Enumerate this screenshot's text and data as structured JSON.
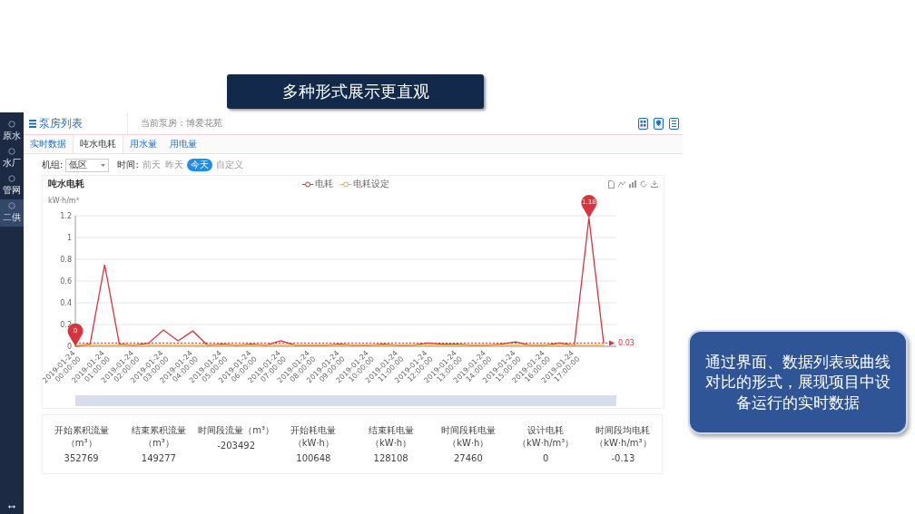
{
  "banner": {
    "title": "多种形式展示更直观"
  },
  "sidebar": {
    "items": [
      {
        "label": "原水",
        "selected": false
      },
      {
        "label": "水厂",
        "selected": false
      },
      {
        "label": "管网",
        "selected": false
      },
      {
        "label": "二供",
        "selected": true
      }
    ]
  },
  "header": {
    "title": "泵房列表",
    "current": "当前泵房：博爱花苑"
  },
  "tabs": [
    {
      "label": "实时数据",
      "selected": false
    },
    {
      "label": "吨水电耗",
      "selected": true
    },
    {
      "label": "用水量",
      "selected": false
    },
    {
      "label": "用电量",
      "selected": false
    }
  ],
  "filters": {
    "unit_label": "机组:",
    "unit_value": "低区",
    "time_label": "时间:",
    "time_options": [
      {
        "label": "前天",
        "selected": false
      },
      {
        "label": "昨天",
        "selected": false
      },
      {
        "label": "今天",
        "selected": true
      },
      {
        "label": "自定义",
        "selected": false
      }
    ]
  },
  "chart": {
    "title": "吨水电耗",
    "chart_data": {
      "type": "line",
      "ylabel": "kW·h/m³",
      "categories": [
        "2019-01-24 00:00:00",
        null,
        "2019-01-24 01:00:00",
        null,
        "2019-01-24 02:00:00",
        null,
        "2019-01-24 03:00:00",
        null,
        "2019-01-24 04:00:00",
        null,
        "2019-01-24 05:00:00",
        null,
        "2019-01-24 06:00:00",
        null,
        "2019-01-24 07:00:00",
        null,
        "2019-01-24 08:00:00",
        null,
        "2019-01-24 09:00:00",
        null,
        "2019-01-24 10:00:00",
        null,
        "2019-01-24 11:00:00",
        null,
        "2019-01-24 12:00:00",
        null,
        "2019-01-24 13:00:00",
        null,
        "2019-01-24 14:00:00",
        null,
        "2019-01-24 15:00:00",
        null,
        "2019-01-24 16:00:00",
        null,
        "2019-01-24 17:00:00",
        null,
        null
      ],
      "ylim": [
        0,
        1.2
      ],
      "yticks": [
        0,
        0.2,
        0.4,
        0.6,
        0.8,
        1,
        1.2
      ],
      "series": [
        {
          "name": "电耗",
          "color": "#d9333f",
          "values": [
            0,
            0.02,
            0.75,
            0.02,
            0.01,
            0.03,
            0.15,
            0.05,
            0.14,
            0.01,
            0.02,
            0.01,
            0.02,
            0.01,
            0.05,
            0.01,
            0.01,
            0.01,
            0.02,
            0.01,
            0.01,
            0.02,
            0.01,
            0.01,
            0.03,
            0.02,
            0.02,
            0.01,
            0.01,
            0.02,
            0.04,
            0.01,
            0.01,
            0.03,
            0.01,
            1.18,
            0.03
          ]
        },
        {
          "name": "电耗设定",
          "color": "#f0b429",
          "values": [
            0.01,
            0.01,
            0.01,
            0.01,
            0.01,
            0.01,
            0.01,
            0.01,
            0.01,
            0.01,
            0.01,
            0.01,
            0.01,
            0.01,
            0.01,
            0.01,
            0.01,
            0.01,
            0.01,
            0.01,
            0.01,
            0.01,
            0.01,
            0.01,
            0.01,
            0.01,
            0.01,
            0.01,
            0.01,
            0.01,
            0.01,
            0.01,
            0.01,
            0.01,
            0.01,
            0.01,
            0.01
          ]
        }
      ],
      "grid": true,
      "annotations": [
        {
          "y": 0,
          "text": "0"
        },
        {
          "y": 1.18,
          "text": "1.18"
        }
      ],
      "ref_lines": [
        {
          "axis": "y",
          "value": 0.03,
          "label": "0.03"
        }
      ]
    }
  },
  "stats": [
    {
      "label": "开始累积流量（m³）",
      "value": "352769"
    },
    {
      "label": "结束累积流量（m³）",
      "value": "149277"
    },
    {
      "label": "时间段流量（m³）",
      "value": "-203492"
    },
    {
      "label": "开始耗电量（kW·h）",
      "value": "100648"
    },
    {
      "label": "结束耗电量（kW·h）",
      "value": "128108"
    },
    {
      "label": "时间段耗电量（kW·h）",
      "value": "27460"
    },
    {
      "label": "设计电耗（kW·h/m³）",
      "value": "0"
    },
    {
      "label": "时间段均电耗（kW·h/m³）",
      "value": "-0.13"
    }
  ],
  "callout": {
    "text": "通过界面、数据列表或曲线对比的形式，展现项目中设备运行的实时数据"
  }
}
